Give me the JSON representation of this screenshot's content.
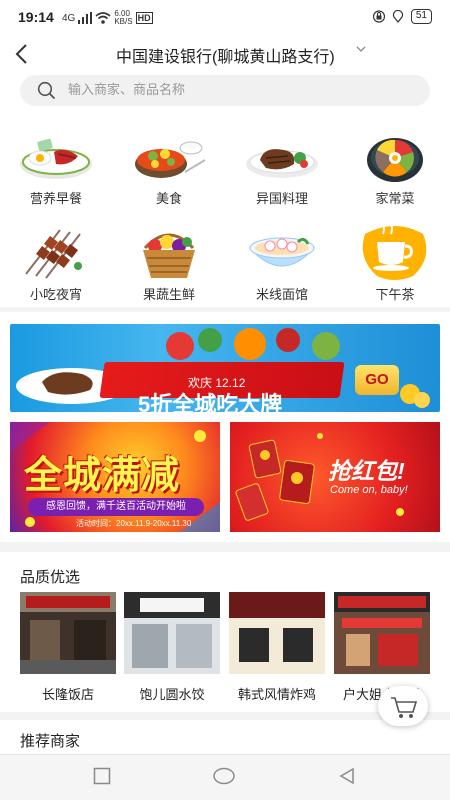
{
  "status_bar": {
    "time": "19:14",
    "network": "4G",
    "speed": "6.00",
    "speed_unit": "KB/S",
    "hd": "HD",
    "battery": "51",
    "icons": [
      "signal-icon",
      "wifi-icon",
      "lock-icon",
      "location-icon"
    ]
  },
  "header": {
    "branch_name": "中国建设银行(聊城黄山路支行)",
    "dropdown_icon": "chevron-down-icon",
    "back_icon": "back-arrow-icon"
  },
  "search": {
    "placeholder": "输入商家、商品名称",
    "icon": "search-icon"
  },
  "categories": [
    {
      "label": "营养早餐",
      "icon": "breakfast-icon"
    },
    {
      "label": "美食",
      "icon": "food-icon"
    },
    {
      "label": "异国料理",
      "icon": "steak-icon"
    },
    {
      "label": "家常菜",
      "icon": "home-dish-icon"
    },
    {
      "label": "小吃夜宵",
      "icon": "skewer-icon"
    },
    {
      "label": "果蔬生鲜",
      "icon": "fruit-basket-icon"
    },
    {
      "label": "米线面馆",
      "icon": "noodle-bowl-icon"
    },
    {
      "label": "下午茶",
      "icon": "coffee-cup-icon"
    }
  ],
  "banners": {
    "main": {
      "subtitle": "欢庆 12.12",
      "headline": "5折全城吃大牌",
      "button": "GO"
    },
    "left": {
      "headline": "全城满减",
      "subtitle": "感恩回馈，满千送百活动开始啦",
      "date": "活动时间：20xx.11.9-20xx.11.30"
    },
    "right": {
      "headline": "抢红包!",
      "subtitle": "Come on, baby!"
    }
  },
  "quality": {
    "title": "品质优选",
    "stores": [
      {
        "name": "长隆饭店"
      },
      {
        "name": "饱儿圆水饺"
      },
      {
        "name": "韩式风情炸鸡"
      },
      {
        "name": "户大姐土豆粉"
      }
    ]
  },
  "recommend": {
    "title": "推荐商家"
  },
  "cart_icon": "cart-icon",
  "nav_bar": {
    "icons": [
      "recent-apps-icon",
      "home-icon",
      "back-icon"
    ]
  },
  "colors": {
    "accent_red": "#e31a2d",
    "banner_blue": "#1a9ae0",
    "search_bg": "#f1f1f1"
  }
}
